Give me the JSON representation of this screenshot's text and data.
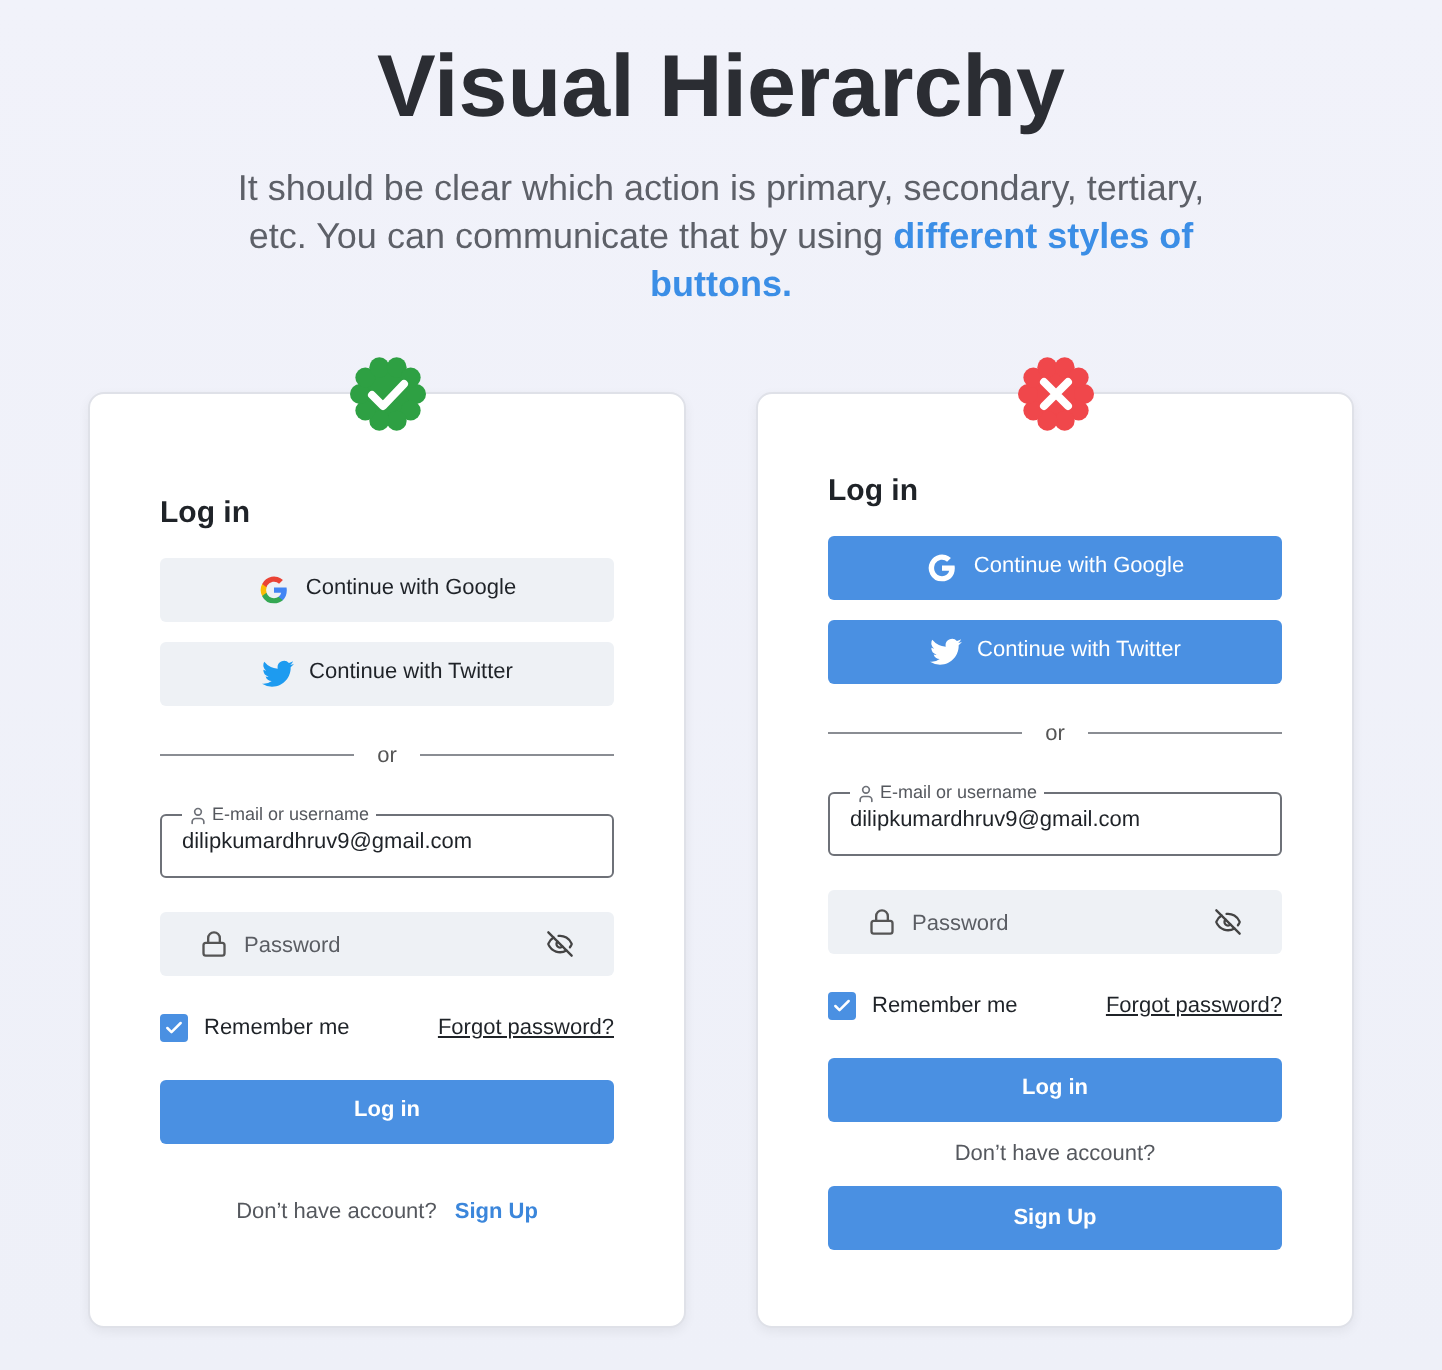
{
  "title": "Visual Hierarchy",
  "subtitle": {
    "text": "It should be clear which action is primary, secondary, tertiary, etc. You can communicate that by using",
    "highlight": "different styles of buttons."
  },
  "examples": [
    {
      "kind": "good",
      "heading": "Log in",
      "social_buttons": [
        {
          "kind": "google",
          "label": "Continue with Google"
        },
        {
          "kind": "twitter",
          "label": "Continue with Twitter"
        }
      ],
      "divider": "or",
      "email": {
        "label": "E-mail or username",
        "value": "dilipkumardhruv9@gmail.com"
      },
      "password": {
        "placeholder": "Password"
      },
      "remember": {
        "label": "Remember me",
        "checked": true
      },
      "forgot": "Forgot password?",
      "login": "Log in",
      "signup_prompt": "Don’t have account?",
      "signup": "Sign Up"
    },
    {
      "kind": "bad",
      "heading": "Log in",
      "social_buttons": [
        {
          "kind": "google",
          "label": "Continue with Google"
        },
        {
          "kind": "twitter",
          "label": "Continue with Twitter"
        }
      ],
      "divider": "or",
      "email": {
        "label": "E-mail or username",
        "value": "dilipkumardhruv9@gmail.com"
      },
      "password": {
        "placeholder": "Password"
      },
      "remember": {
        "label": "Remember me",
        "checked": true
      },
      "forgot": "Forgot password?",
      "login": "Log in",
      "signup_prompt": "Don’t have account?",
      "signup": "Sign Up"
    }
  ]
}
